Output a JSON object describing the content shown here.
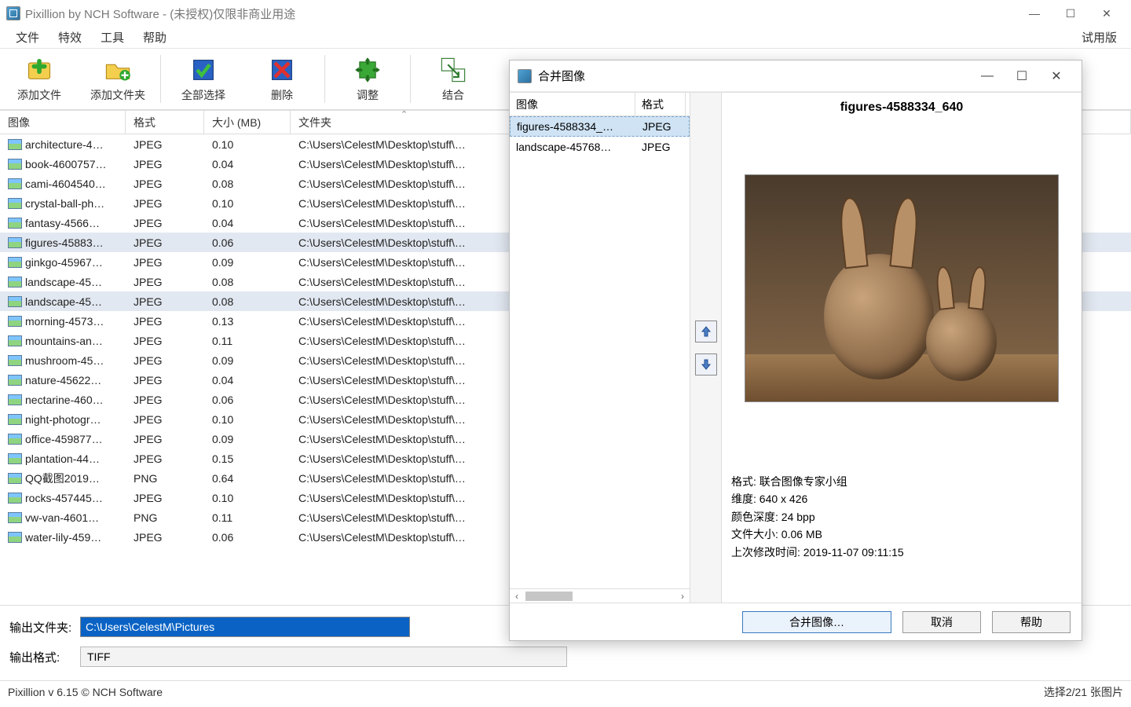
{
  "title": "Pixillion by NCH Software - (未授权)仅限非商业用途",
  "menubar": {
    "file": "文件",
    "effects": "特效",
    "tools": "工具",
    "help": "帮助",
    "trial": "试用版"
  },
  "toolbar": {
    "add_file": "添加文件",
    "add_folder": "添加文件夹",
    "select_all": "全部选择",
    "delete": "删除",
    "adjust": "调整",
    "combine": "结合"
  },
  "columns": {
    "image": "图像",
    "format": "格式",
    "size": "大小 (MB)",
    "folder": "文件夹"
  },
  "selected_indices": [
    5,
    8
  ],
  "files": [
    {
      "name": "architecture-4…",
      "fmt": "JPEG",
      "size": "0.10",
      "folder": "C:\\Users\\CelestM\\Desktop\\stuff\\…"
    },
    {
      "name": "book-4600757…",
      "fmt": "JPEG",
      "size": "0.04",
      "folder": "C:\\Users\\CelestM\\Desktop\\stuff\\…"
    },
    {
      "name": "cami-4604540…",
      "fmt": "JPEG",
      "size": "0.08",
      "folder": "C:\\Users\\CelestM\\Desktop\\stuff\\…"
    },
    {
      "name": "crystal-ball-ph…",
      "fmt": "JPEG",
      "size": "0.10",
      "folder": "C:\\Users\\CelestM\\Desktop\\stuff\\…"
    },
    {
      "name": "fantasy-4566…",
      "fmt": "JPEG",
      "size": "0.04",
      "folder": "C:\\Users\\CelestM\\Desktop\\stuff\\…"
    },
    {
      "name": "figures-45883…",
      "fmt": "JPEG",
      "size": "0.06",
      "folder": "C:\\Users\\CelestM\\Desktop\\stuff\\…"
    },
    {
      "name": "ginkgo-45967…",
      "fmt": "JPEG",
      "size": "0.09",
      "folder": "C:\\Users\\CelestM\\Desktop\\stuff\\…"
    },
    {
      "name": "landscape-45…",
      "fmt": "JPEG",
      "size": "0.08",
      "folder": "C:\\Users\\CelestM\\Desktop\\stuff\\…"
    },
    {
      "name": "landscape-45…",
      "fmt": "JPEG",
      "size": "0.08",
      "folder": "C:\\Users\\CelestM\\Desktop\\stuff\\…"
    },
    {
      "name": "morning-4573…",
      "fmt": "JPEG",
      "size": "0.13",
      "folder": "C:\\Users\\CelestM\\Desktop\\stuff\\…"
    },
    {
      "name": "mountains-an…",
      "fmt": "JPEG",
      "size": "0.11",
      "folder": "C:\\Users\\CelestM\\Desktop\\stuff\\…"
    },
    {
      "name": "mushroom-45…",
      "fmt": "JPEG",
      "size": "0.09",
      "folder": "C:\\Users\\CelestM\\Desktop\\stuff\\…"
    },
    {
      "name": "nature-45622…",
      "fmt": "JPEG",
      "size": "0.04",
      "folder": "C:\\Users\\CelestM\\Desktop\\stuff\\…"
    },
    {
      "name": "nectarine-460…",
      "fmt": "JPEG",
      "size": "0.06",
      "folder": "C:\\Users\\CelestM\\Desktop\\stuff\\…"
    },
    {
      "name": "night-photogr…",
      "fmt": "JPEG",
      "size": "0.10",
      "folder": "C:\\Users\\CelestM\\Desktop\\stuff\\…"
    },
    {
      "name": "office-459877…",
      "fmt": "JPEG",
      "size": "0.09",
      "folder": "C:\\Users\\CelestM\\Desktop\\stuff\\…"
    },
    {
      "name": "plantation-44…",
      "fmt": "JPEG",
      "size": "0.15",
      "folder": "C:\\Users\\CelestM\\Desktop\\stuff\\…"
    },
    {
      "name": "QQ截图2019…",
      "fmt": "PNG",
      "size": "0.64",
      "folder": "C:\\Users\\CelestM\\Desktop\\stuff\\…"
    },
    {
      "name": "rocks-457445…",
      "fmt": "JPEG",
      "size": "0.10",
      "folder": "C:\\Users\\CelestM\\Desktop\\stuff\\…"
    },
    {
      "name": "vw-van-4601…",
      "fmt": "PNG",
      "size": "0.11",
      "folder": "C:\\Users\\CelestM\\Desktop\\stuff\\…"
    },
    {
      "name": "water-lily-459…",
      "fmt": "JPEG",
      "size": "0.06",
      "folder": "C:\\Users\\CelestM\\Desktop\\stuff\\…"
    }
  ],
  "output": {
    "folder_label": "输出文件夹:",
    "folder_value": "C:\\Users\\CelestM\\Pictures",
    "format_label": "输出格式:",
    "format_value": "TIFF"
  },
  "status": {
    "left": "Pixillion v 6.15 © NCH Software",
    "right": "选择2/21 张图片"
  },
  "dialog": {
    "title": "合并图像",
    "columns": {
      "image": "图像",
      "format": "格式"
    },
    "rows": [
      {
        "name": "figures-4588334_…",
        "fmt": "JPEG",
        "selected": true
      },
      {
        "name": "landscape-45768…",
        "fmt": "JPEG",
        "selected": false
      }
    ],
    "preview_title": "figures-4588334_640",
    "meta": {
      "l_format": "格式:",
      "v_format": "联合图像专家小组",
      "l_dim": "维度:",
      "v_dim": "640 x 426",
      "l_depth": "颜色深度:",
      "v_depth": "24 bpp",
      "l_size": "文件大小:",
      "v_size": "0.06 MB",
      "l_mod": "上次修改时间:",
      "v_mod": "2019-11-07 09:11:15"
    },
    "buttons": {
      "merge": "合并图像…",
      "cancel": "取消",
      "help": "帮助"
    }
  }
}
